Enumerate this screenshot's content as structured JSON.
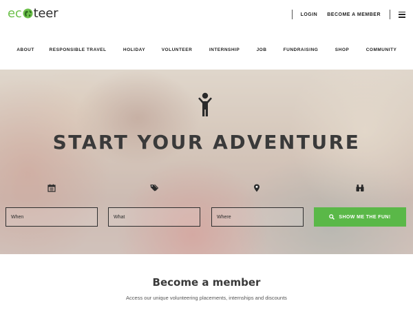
{
  "header": {
    "logo": {
      "part1": "ec",
      "part2": "teer",
      "icon": "globe-icon"
    },
    "links": [
      "LOGIN",
      "BECOME A MEMBER"
    ],
    "menu_icon": "hamburger-icon"
  },
  "nav": {
    "items": [
      "ABOUT",
      "RESPONSIBLE TRAVEL",
      "HOLIDAY",
      "VOLUNTEER",
      "INTERNSHIP",
      "JOB",
      "FUNDRAISING",
      "SHOP",
      "COMMUNITY"
    ]
  },
  "hero": {
    "icon": "person-arms-up-icon",
    "title": "START YOUR ADVENTURE",
    "fields": [
      {
        "icon": "calendar-icon",
        "placeholder": "When"
      },
      {
        "icon": "tags-icon",
        "placeholder": "What"
      },
      {
        "icon": "map-pin-icon",
        "placeholder": "Where"
      }
    ],
    "button": {
      "icon": "binoculars-icon",
      "label": "SHOW ME THE FUN!"
    }
  },
  "member": {
    "title": "Become a member",
    "subtitle": "Access our unique volunteering placements, internships and discounts"
  },
  "colors": {
    "brand_green": "#6cc04a",
    "button_green": "#5ab848",
    "text_dark": "#3a3a3a"
  }
}
